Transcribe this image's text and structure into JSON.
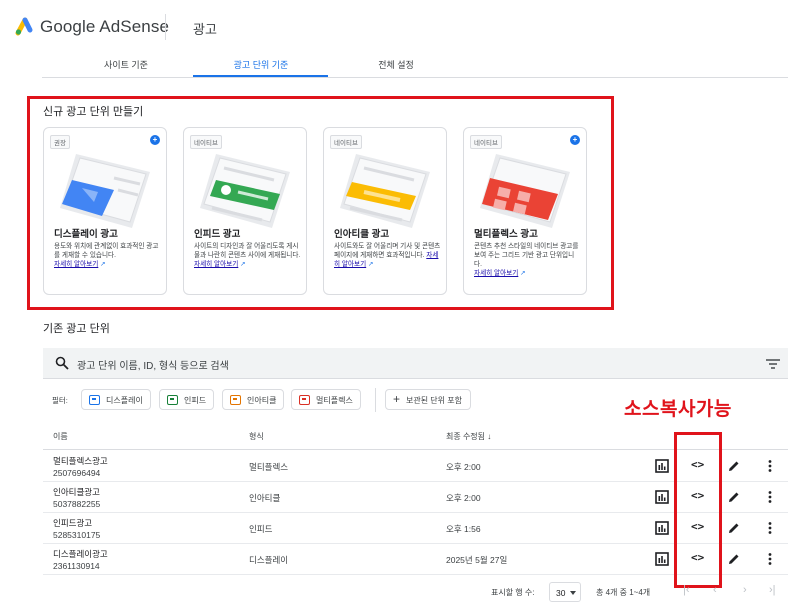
{
  "header": {
    "brand": "Google AdSense",
    "page_title": "광고"
  },
  "tabs": [
    {
      "label": "사이트 기준",
      "active": false
    },
    {
      "label": "광고 단위 기준",
      "active": true
    },
    {
      "label": "전체 설정",
      "active": false
    }
  ],
  "new_ad_units": {
    "title": "신규 광고 단위 만들기",
    "cards": [
      {
        "badge": "권장",
        "title": "디스플레이 광고",
        "desc": "용도와 위치에 관계없이 효과적인 광고를 게재할 수 있습니다.",
        "link": "자세히 알아보기",
        "has_plus": true
      },
      {
        "badge": "네이티브",
        "title": "인피드 광고",
        "desc": "사이트의 디자인과 잘 어울리도록 게시물과 나란히 콘텐츠 사이에 게재됩니다.",
        "link": "자세히 알아보기",
        "has_plus": false
      },
      {
        "badge": "네이티브",
        "title": "인아티클 광고",
        "desc": "사이트와도 잘 어울리며 기사 및 콘텐츠 페이지에 게재하면 효과적입니다.",
        "link": "자세히 알아보기",
        "has_plus": false
      },
      {
        "badge": "네이티브",
        "title": "멀티플렉스 광고",
        "desc": "콘텐츠 추천 스타일의 네이티브 광고를 보여 주는 그리드 기반 광고 단위입니다.",
        "link": "자세히 알아보기",
        "has_plus": true
      }
    ]
  },
  "existing": {
    "title": "기존 광고 단위",
    "search_placeholder": "광고 단위 이름, ID, 형식 등으로 검색",
    "filter_label": "필터:",
    "filters": [
      {
        "label": "디스플레이",
        "color": "#1a73e8"
      },
      {
        "label": "인피드",
        "color": "#188038"
      },
      {
        "label": "인아티클",
        "color": "#e37400"
      },
      {
        "label": "멀티플렉스",
        "color": "#d93025"
      }
    ],
    "archived_label": "보관된 단위 포함",
    "columns": {
      "name": "이름",
      "type": "형식",
      "updated": "최종 수정됨 ↓"
    },
    "rows": [
      {
        "name": "멀티플렉스광고",
        "id": "2507696494",
        "type": "멀티플렉스",
        "updated": "오후 2:00"
      },
      {
        "name": "인아티클광고",
        "id": "5037882255",
        "type": "인아티클",
        "updated": "오후 2:00"
      },
      {
        "name": "인피드광고",
        "id": "5285310175",
        "type": "인피드",
        "updated": "오후 1:56"
      },
      {
        "name": "디스플레이광고",
        "id": "2361130914",
        "type": "디스플레이",
        "updated": "2025년 5월 27일"
      }
    ],
    "code_icon_glyph": "<>",
    "pagination": {
      "rows_label": "표시할 행 수:",
      "rows_value": "30",
      "range": "총 4개 중 1~4개"
    }
  },
  "annotation": {
    "copy_note": "소스복사가능"
  },
  "colors": {
    "accent": "#1a73e8",
    "highlight_red": "#e0131b"
  },
  "icons": [
    "adsense-logo-icon",
    "search-icon",
    "filter-list-icon",
    "bar-chart-icon",
    "code-icon",
    "edit-icon",
    "more-vert-icon",
    "external-link-icon",
    "add-circle-icon"
  ]
}
